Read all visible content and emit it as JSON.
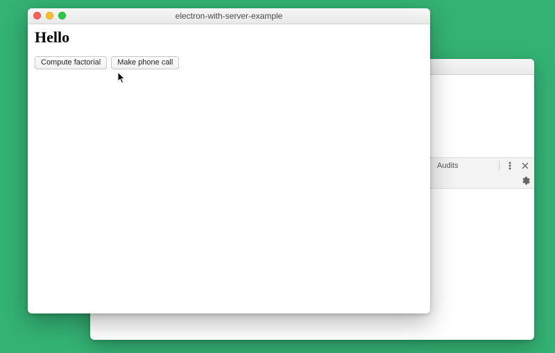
{
  "devtools": {
    "tab_label": "Audits"
  },
  "app": {
    "title": "electron-with-server-example",
    "heading": "Hello",
    "buttons": {
      "compute_factorial": "Compute factorial",
      "make_phone_call": "Make phone call"
    }
  }
}
